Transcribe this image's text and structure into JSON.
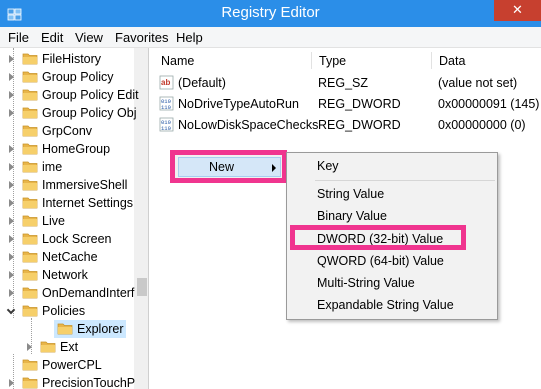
{
  "window": {
    "title": "Registry Editor",
    "close_glyph": "✕"
  },
  "menu": [
    "File",
    "Edit",
    "View",
    "Favorites",
    "Help"
  ],
  "tree": {
    "items": [
      {
        "label": "FileHistory",
        "expander": "collapsed"
      },
      {
        "label": "Group Policy",
        "expander": "collapsed"
      },
      {
        "label": "Group Policy Edit",
        "expander": "collapsed"
      },
      {
        "label": "Group Policy Obj",
        "expander": "collapsed"
      },
      {
        "label": "GrpConv",
        "expander": "none"
      },
      {
        "label": "HomeGroup",
        "expander": "collapsed"
      },
      {
        "label": "ime",
        "expander": "collapsed"
      },
      {
        "label": "ImmersiveShell",
        "expander": "collapsed"
      },
      {
        "label": "Internet Settings",
        "expander": "collapsed"
      },
      {
        "label": "Live",
        "expander": "collapsed"
      },
      {
        "label": "Lock Screen",
        "expander": "collapsed"
      },
      {
        "label": "NetCache",
        "expander": "collapsed"
      },
      {
        "label": "Network",
        "expander": "collapsed"
      },
      {
        "label": "OnDemandInterf",
        "expander": "collapsed"
      },
      {
        "label": "Policies",
        "expander": "expanded"
      },
      {
        "label": "Explorer",
        "expander": "none",
        "child": true,
        "selected": true
      },
      {
        "label": "Ext",
        "expander": "collapsed",
        "child": true
      },
      {
        "label": "PowerCPL",
        "expander": "none"
      },
      {
        "label": "PrecisionTouchP",
        "expander": "collapsed"
      }
    ]
  },
  "list": {
    "columns": [
      "Name",
      "Type",
      "Data"
    ],
    "rows": [
      {
        "icon": "string-value-icon",
        "name": "(Default)",
        "type": "REG_SZ",
        "data": "(value not set)"
      },
      {
        "icon": "binary-value-icon",
        "name": "NoDriveTypeAutoRun",
        "type": "REG_DWORD",
        "data": "0x00000091 (145)"
      },
      {
        "icon": "binary-value-icon",
        "name": "NoLowDiskSpaceChecks",
        "type": "REG_DWORD",
        "data": "0x00000000 (0)"
      }
    ]
  },
  "context_menu": {
    "new_label": "New"
  },
  "submenu": {
    "key": "Key",
    "string": "String Value",
    "binary": "Binary Value",
    "dword": "DWORD (32-bit) Value",
    "qword": "QWORD (64-bit) Value",
    "multi": "Multi-String Value",
    "expandable": "Expandable String Value"
  },
  "colors": {
    "titlebar": "#2b8ee8",
    "highlight": "#f0358f",
    "selection": "#cce8ff",
    "close": "#c7402f"
  }
}
